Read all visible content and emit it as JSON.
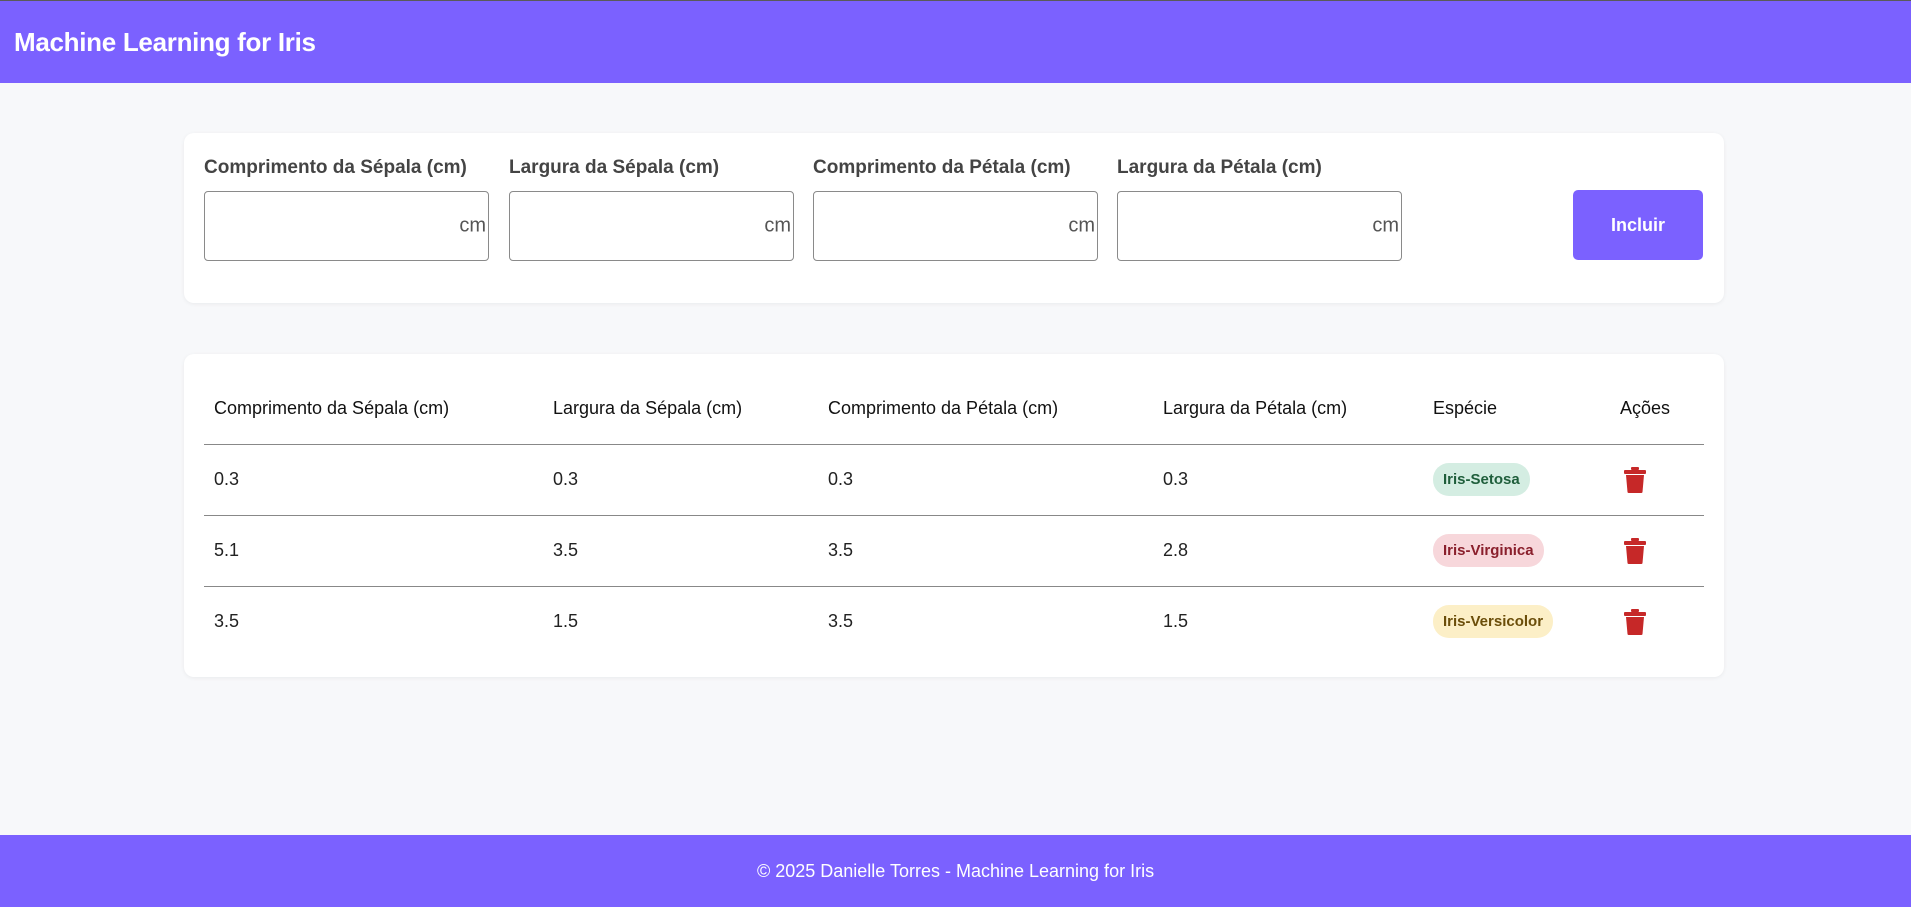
{
  "header": {
    "title": "Machine Learning for Iris"
  },
  "form": {
    "fields": [
      {
        "label": "Comprimento da Sépala (cm)",
        "value": "",
        "suffix": "cm"
      },
      {
        "label": "Largura da Sépala (cm)",
        "value": "",
        "suffix": "cm"
      },
      {
        "label": "Comprimento da Pétala (cm)",
        "value": "",
        "suffix": "cm"
      },
      {
        "label": "Largura da Pétala (cm)",
        "value": "",
        "suffix": "cm"
      }
    ],
    "submit_label": "Incluir"
  },
  "table": {
    "columns": [
      "Comprimento da Sépala (cm)",
      "Largura da Sépala (cm)",
      "Comprimento da Pétala (cm)",
      "Largura da Pétala (cm)",
      "Espécie",
      "Ações"
    ],
    "rows": [
      {
        "sepal_length": "0.3",
        "sepal_width": "0.3",
        "petal_length": "0.3",
        "petal_width": "0.3",
        "species": "Iris-Setosa",
        "action_icon": "trash-icon"
      },
      {
        "sepal_length": "5.1",
        "sepal_width": "3.5",
        "petal_length": "3.5",
        "petal_width": "2.8",
        "species": "Iris-Virginica",
        "action_icon": "trash-icon"
      },
      {
        "sepal_length": "3.5",
        "sepal_width": "1.5",
        "petal_length": "3.5",
        "petal_width": "1.5",
        "species": "Iris-Versicolor",
        "action_icon": "trash-icon"
      }
    ]
  },
  "species_colors": {
    "Iris-Setosa": {
      "bg": "#d4ede2",
      "fg": "#1f5e3b"
    },
    "Iris-Virginica": {
      "bg": "#f7d7db",
      "fg": "#8a1f2c"
    },
    "Iris-Versicolor": {
      "bg": "#fcefc7",
      "fg": "#6b4e0a"
    }
  },
  "colors": {
    "accent": "#7b61ff",
    "delete": "#c62828"
  },
  "footer": {
    "text": "© 2025 Danielle Torres - Machine Learning for Iris"
  }
}
